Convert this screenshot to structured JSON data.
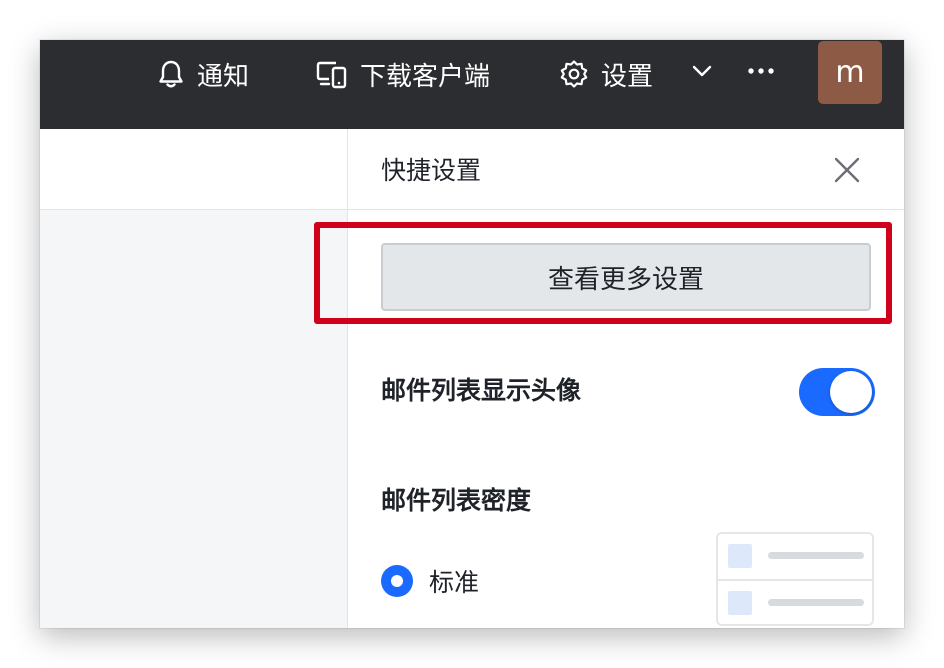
{
  "topbar": {
    "notify_label": "通知",
    "download_label": "下载客户端",
    "settings_label": "设置",
    "avatar_letter": "m",
    "avatar_color": "#8d5a46",
    "icons": [
      "bell-icon",
      "devices-icon",
      "gear-icon",
      "chevron-down-icon",
      "more-icon"
    ]
  },
  "panel": {
    "title": "快捷设置",
    "more_settings_button": "查看更多设置",
    "show_avatar_label": "邮件列表显示头像",
    "show_avatar_enabled": true,
    "density_label": "邮件列表密度",
    "density_selected": "标准"
  },
  "colors": {
    "topbar_bg": "#2b2d30",
    "accent": "#1a6aff",
    "highlight": "#d0021b"
  }
}
